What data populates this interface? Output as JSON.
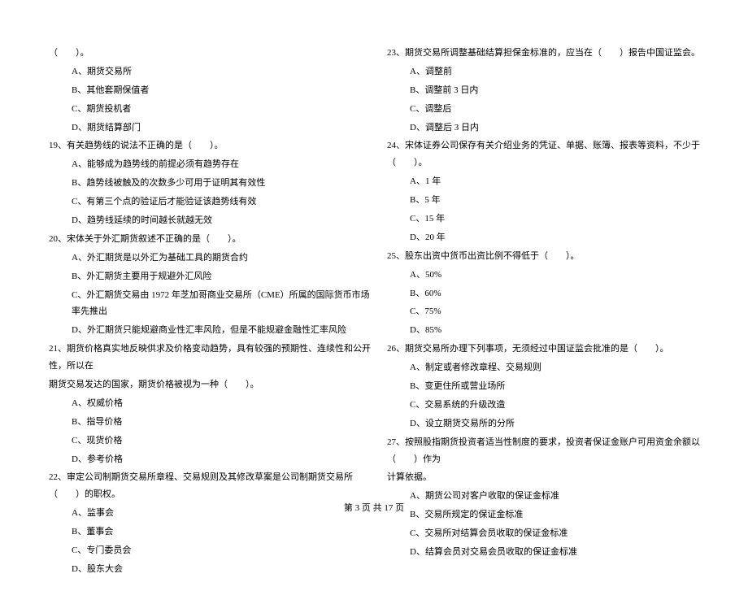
{
  "left": {
    "pre": "（　　）。",
    "opts18": [
      "A、期货交易所",
      "B、其他套期保值者",
      "C、期货投机者",
      "D、期货结算部门"
    ],
    "q19": "19、有关趋势线的说法不正确的是（　　）。",
    "opts19": [
      "A、能够成为趋势线的前提必须有趋势存在",
      "B、趋势线被触及的次数多少可用于证明其有效性",
      "C、有第三个点的验证后才能验证该趋势线有效",
      "D、趋势线延续的时间越长就越无效"
    ],
    "q20": "20、宋体关于外汇期货叙述不正确的是（　　）。",
    "opts20": [
      "A、外汇期货是以外汇为基础工具的期货合约",
      "B、外汇期货主要用于规避外汇风险",
      "C、外汇期货交易由 1972 年芝加哥商业交易所（CME）所属的国际货币市场率先推出",
      "D、外汇期货只能规避商业性汇率风险，但是不能规避金融性汇率风险"
    ],
    "q21a": "21、期货价格真实地反映供求及价格变动趋势，具有较强的预期性、连续性和公开性，所以在",
    "q21b": "期货交易发达的国家，期货价格被视为一种（　　）。",
    "opts21": [
      "A、权威价格",
      "B、指导价格",
      "C、现货价格",
      "D、参考价格"
    ],
    "q22": "22、审定公司制期货交易所章程、交易规则及其修改草案是公司制期货交易所（　　）的职权。",
    "opts22": [
      "A、监事会",
      "B、董事会",
      "C、专门委员会",
      "D、股东大会"
    ]
  },
  "right": {
    "q23": "23、期货交易所调整基础结算担保金标准的，应当在（　　）报告中国证监会。",
    "opts23": [
      "A、调整前",
      "B、调整前 3 日内",
      "C、调整后",
      "D、调整后 3 日内"
    ],
    "q24": "24、宋体证券公司保存有关介绍业务的凭证、单据、账簿、报表等资料，不少于（　　）。",
    "opts24": [
      "A、1 年",
      "B、5 年",
      "C、15 年",
      "D、20 年"
    ],
    "q25": "25、股东出资中货币出资比例不得低于（　　）。",
    "opts25": [
      "A、50%",
      "B、60%",
      "C、75%",
      "D、85%"
    ],
    "q26": "26、期货交易所办理下列事项，无须经过中国证监会批准的是（　　）。",
    "opts26": [
      "A、制定或者修改章程、交易规则",
      "B、变更住所或营业场所",
      "C、交易系统的升级改造",
      "D、设立期货交易所的分所"
    ],
    "q27a": "27、按照股指期货投资者适当性制度的要求，投资者保证金账户可用资金余额以（　　）作为",
    "q27b": "计算依据。",
    "opts27": [
      "A、期货公司对客户收取的保证金标准",
      "B、交易所规定的保证金标准",
      "C、交易所对结算会员收取的保证金标准",
      "D、结算会员对交易会员收取的保证金标准"
    ]
  },
  "footer": "第 3 页 共 17 页"
}
